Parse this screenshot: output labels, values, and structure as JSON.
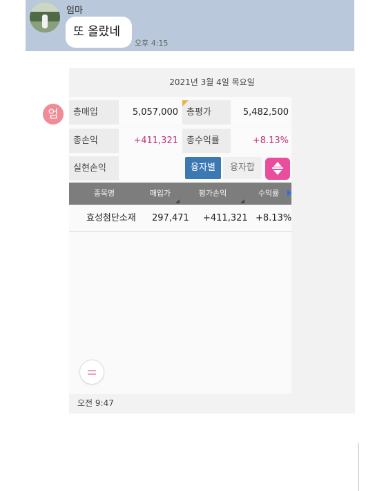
{
  "top_message": {
    "sender": "엄마",
    "text": "또 올랐네",
    "time": "오후 4:15"
  },
  "date_separator": "2021년 3월 4일 목요일",
  "image_message": {
    "sender_badge": "엄",
    "time": "오전 9:47",
    "summary": {
      "total_purchase_label": "총매입",
      "total_purchase_value": "5,057,000",
      "total_eval_label": "총평가",
      "total_eval_value": "5,482,500",
      "total_pl_label": "총손익",
      "total_pl_value": "+411,321",
      "total_return_label": "총수익률",
      "total_return_value": "+8.13%",
      "realized_pl_label": "실현손익",
      "realized_pl_value": ""
    },
    "toggle": {
      "active_label": "융자별",
      "inactive_label": "융자합"
    },
    "table": {
      "headers": [
        "종목명",
        "매입가",
        "평가손익",
        "수익률"
      ],
      "rows": [
        [
          "효성첨단소재",
          "297,471",
          "+411,321",
          "+8.13%"
        ]
      ]
    }
  },
  "colors": {
    "chat_background": "#b9c9db",
    "badge": "#f08c96",
    "positive": "#c0307a",
    "toggle_active": "#3c78b2",
    "sort_button": "#e94e9c",
    "table_header": "#7d7d7d"
  }
}
